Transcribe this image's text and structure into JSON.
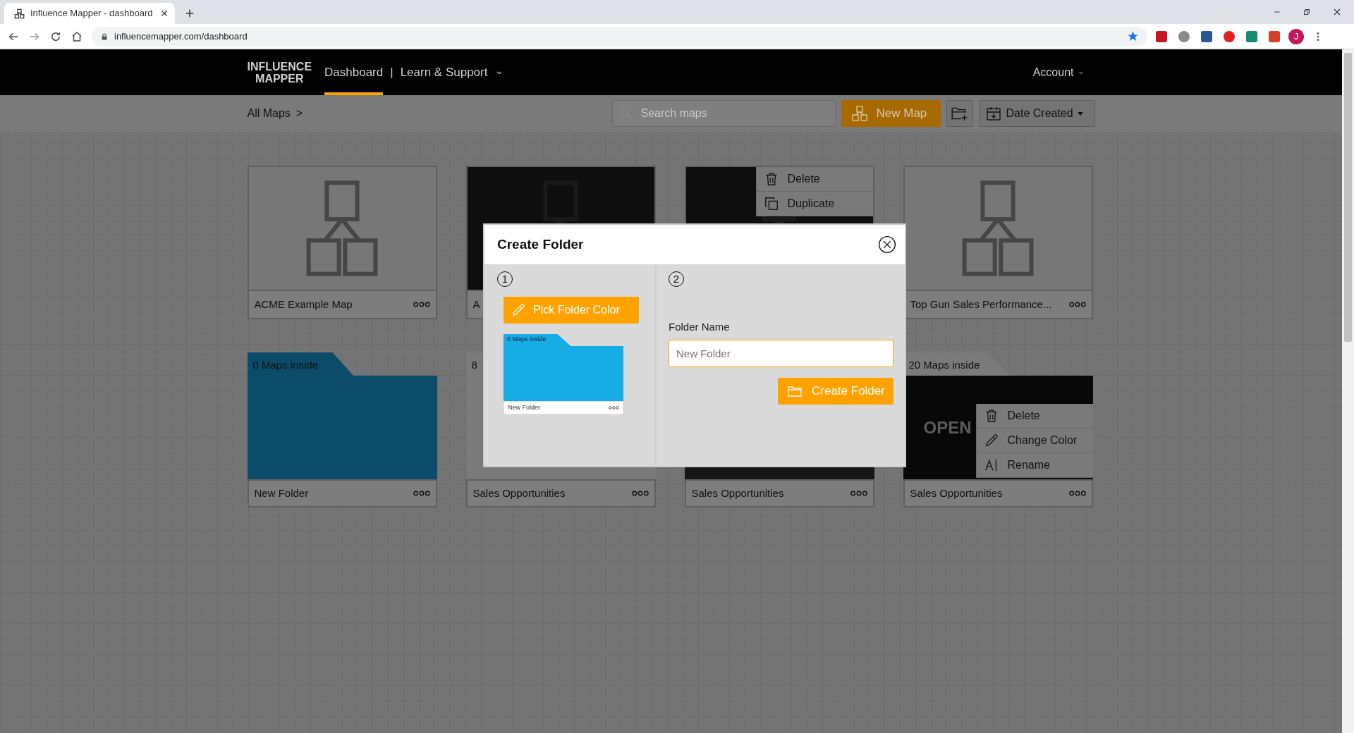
{
  "browser": {
    "tab_title": "Influence Mapper - dashboard",
    "url": "influencemapper.com/dashboard",
    "avatar": "J"
  },
  "nav": {
    "logo": [
      "INFLUENCE",
      "MAPPER"
    ],
    "links": [
      {
        "label": "Dashboard",
        "selected": true,
        "dropdown": false
      },
      {
        "label": "Learn & Support",
        "selected": false,
        "dropdown": true
      }
    ],
    "separator": "|",
    "account": "Account"
  },
  "toolbar": {
    "breadcrumb": "All Maps",
    "breadcrumb_arrow": ">",
    "search": {
      "placeholder": "Search maps"
    },
    "new_map": "New Map",
    "sort": "Date Created"
  },
  "cards": [
    {
      "kind": "map",
      "hover": false,
      "title": "ACME Example Map"
    },
    {
      "kind": "map",
      "hover": true,
      "title": "A"
    },
    {
      "kind": "map",
      "hover": true,
      "menu": [
        {
          "kind": "delete",
          "label": "Delete"
        },
        {
          "kind": "duplicate",
          "label": "Duplicate"
        }
      ]
    },
    {
      "kind": "map",
      "hover": false,
      "title": "Top Gun Sales Performance..."
    },
    {
      "kind": "folder",
      "color": "#0b4c6a",
      "count": "0 Maps inside",
      "title": "New Folder",
      "hover": false
    },
    {
      "kind": "folder",
      "color": "#7a7a7a",
      "count": "8",
      "title": "Sales Opportunities",
      "hover": false
    },
    {
      "kind": "folder",
      "color": "#161616",
      "title": "Sales Opportunities",
      "hover": false
    },
    {
      "kind": "folder",
      "color": "#7a7a7a",
      "count": "20 Maps inside",
      "title": "Sales Opportunities",
      "hover": true,
      "hover_label": "OPEN",
      "menu": [
        {
          "kind": "delete",
          "label": "Delete"
        },
        {
          "kind": "change_color",
          "label": "Change Color"
        },
        {
          "kind": "rename",
          "label": "Rename"
        }
      ]
    }
  ],
  "modal": {
    "title": "Create Folder",
    "steps": [
      "1",
      "2"
    ],
    "pick_color": "Pick Folder Color",
    "preview": {
      "count": "0 Maps inside",
      "title": "New Folder",
      "color": "#16ace6"
    },
    "name_label": "Folder Name",
    "name_field": {
      "placeholder": "New Folder"
    },
    "submit": "Create Folder"
  }
}
